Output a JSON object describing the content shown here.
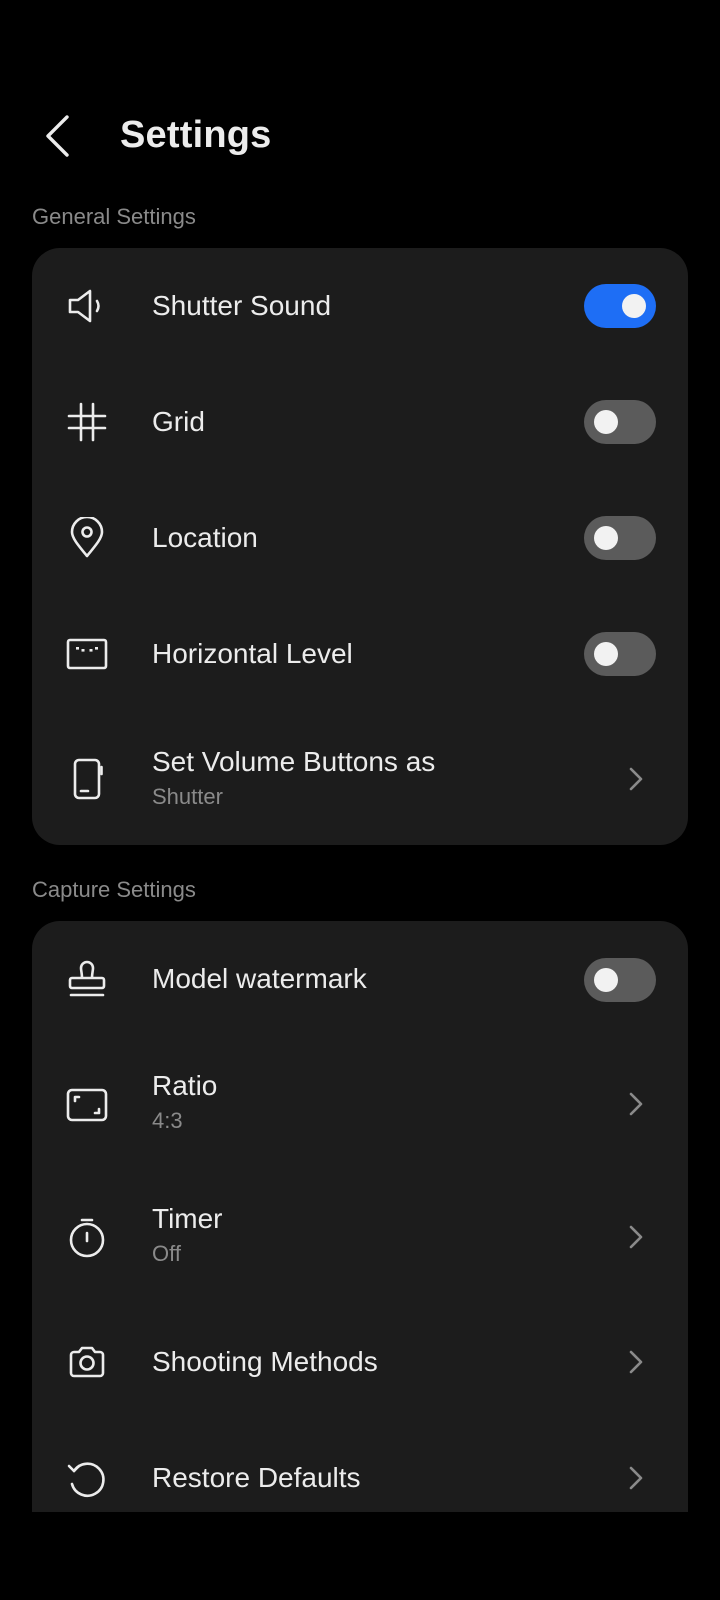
{
  "header": {
    "title": "Settings",
    "back_icon": "chevron-left-icon"
  },
  "sections": [
    {
      "label": "General Settings",
      "items": [
        {
          "icon": "speaker-icon",
          "title": "Shutter Sound",
          "control": "toggle",
          "on": true
        },
        {
          "icon": "grid-icon",
          "title": "Grid",
          "control": "toggle",
          "on": false
        },
        {
          "icon": "location-pin-icon",
          "title": "Location",
          "control": "toggle",
          "on": false
        },
        {
          "icon": "horizontal-level-icon",
          "title": "Horizontal Level",
          "control": "toggle",
          "on": false
        },
        {
          "icon": "phone-volume-icon",
          "title": "Set Volume Buttons as",
          "subtitle": "Shutter",
          "control": "chevron"
        }
      ]
    },
    {
      "label": "Capture Settings",
      "items": [
        {
          "icon": "stamp-icon",
          "title": "Model watermark",
          "control": "toggle",
          "on": false
        },
        {
          "icon": "ratio-frame-icon",
          "title": "Ratio",
          "subtitle": "4:3",
          "control": "chevron"
        },
        {
          "icon": "timer-icon",
          "title": "Timer",
          "subtitle": "Off",
          "control": "chevron"
        },
        {
          "icon": "camera-icon",
          "title": "Shooting Methods",
          "control": "chevron"
        },
        {
          "icon": "restore-icon",
          "title": "Restore Defaults",
          "control": "chevron"
        }
      ]
    }
  ],
  "colors": {
    "background": "#000000",
    "card": "#1c1c1c",
    "accent": "#1e6ef5",
    "toggle_off": "#5b5b5b",
    "text_primary": "#ececec",
    "text_secondary": "#8a8a8a"
  }
}
